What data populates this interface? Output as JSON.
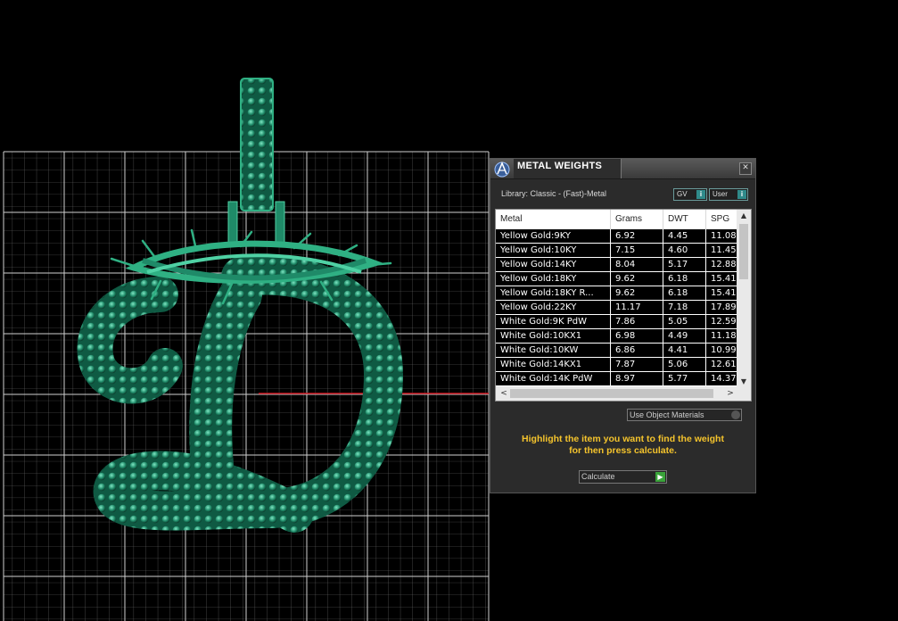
{
  "panel": {
    "title": "METAL WEIGHTS",
    "close_glyph": "✕",
    "library_label": "Library: Classic - (Fast)-Metal",
    "gv_label": "GV",
    "user_label": "User",
    "info_glyph": "i",
    "use_object_materials": "Use Object Materials",
    "hint_line1": "Highlight the item you want to find the weight",
    "hint_line2": "for then press calculate.",
    "calculate_label": "Calculate",
    "calculate_glyph": "▶"
  },
  "table": {
    "columns": [
      "Metal",
      "Grams",
      "DWT",
      "SPG"
    ],
    "rows": [
      [
        "Yellow Gold:9KY",
        "6.92",
        "4.45",
        "11.08"
      ],
      [
        "Yellow Gold:10KY",
        "7.15",
        "4.60",
        "11.45"
      ],
      [
        "Yellow Gold:14KY",
        "8.04",
        "5.17",
        "12.88"
      ],
      [
        "Yellow Gold:18KY",
        "9.62",
        "6.18",
        "15.41"
      ],
      [
        "Yellow Gold:18KY R...",
        "9.62",
        "6.18",
        "15.41"
      ],
      [
        "Yellow Gold:22KY",
        "11.17",
        "7.18",
        "17.89"
      ],
      [
        "White Gold:9K PdW",
        "7.86",
        "5.05",
        "12.59"
      ],
      [
        "White Gold:10KX1",
        "6.98",
        "4.49",
        "11.18"
      ],
      [
        "White Gold:10KW",
        "6.86",
        "4.41",
        "10.99"
      ],
      [
        "White Gold:14KX1",
        "7.87",
        "5.06",
        "12.61"
      ],
      [
        "White Gold:14K PdW",
        "8.97",
        "5.77",
        "14.37"
      ]
    ],
    "scroll_up": "▲",
    "scroll_down": "▼",
    "scroll_left": "<",
    "scroll_right": ">"
  },
  "colors": {
    "background": "#000000",
    "grid": "#8a8a8a",
    "model": "#1f8a68",
    "model_highlight": "#4fd1a4",
    "axis": "#c8141e",
    "hint": "#f5c42c"
  }
}
